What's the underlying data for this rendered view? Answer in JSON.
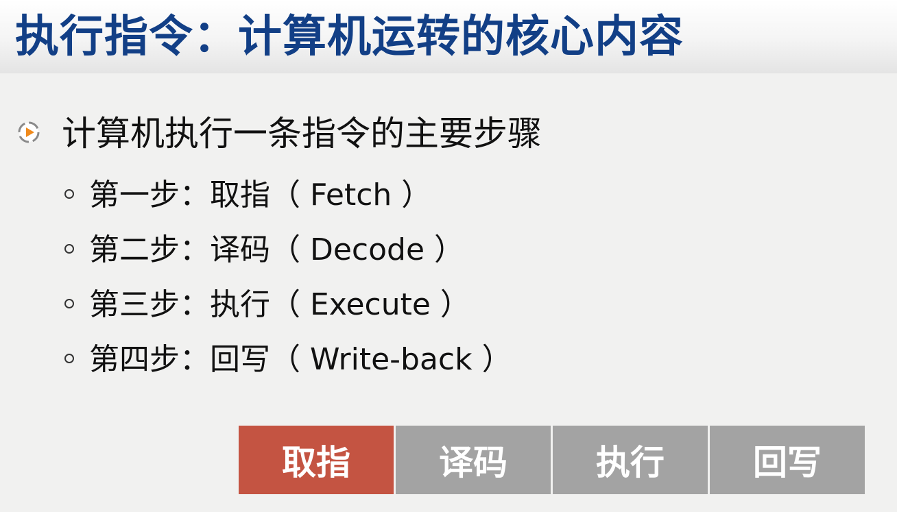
{
  "slide": {
    "title": "执行指令：计算机运转的核心内容",
    "main_bullet": "计算机执行一条指令的主要步骤",
    "steps": [
      "第一步：取指（ Fetch ）",
      "第二步：译码（ Decode ）",
      "第三步：执行（ Execute ）",
      "第四步：回写（ Write-back ）"
    ],
    "stages": [
      {
        "label": "取指",
        "state": "active"
      },
      {
        "label": "译码",
        "state": "inactive"
      },
      {
        "label": "执行",
        "state": "inactive"
      },
      {
        "label": "回写",
        "state": "inactive"
      }
    ]
  },
  "icons": {
    "bullet": "play-circle-icon"
  },
  "colors": {
    "title": "#123f86",
    "active_stage": "#c45442",
    "inactive_stage": "#a3a3a3",
    "bullet_icon_accent": "#f08a1c"
  }
}
